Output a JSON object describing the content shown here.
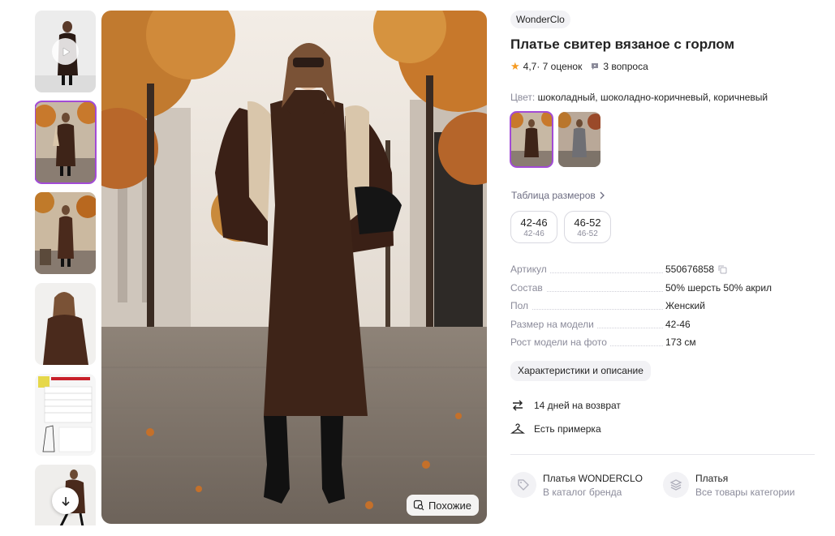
{
  "gallery": {
    "thumbnails": [
      {
        "kind": "video",
        "icon": "play-icon"
      },
      {
        "kind": "photo",
        "active": true
      },
      {
        "kind": "photo"
      },
      {
        "kind": "photo"
      },
      {
        "kind": "size-chart"
      },
      {
        "kind": "photo"
      }
    ],
    "scroll_icon": "arrow-down-icon",
    "similar_label": "Похожие",
    "similar_icon": "image-search-icon"
  },
  "product": {
    "brand": "WonderClo",
    "title": "Платье свитер вязаное с горлом",
    "rating": "4,7",
    "reviews": " · 7 оценок",
    "questions": "3 вопроса",
    "color_label": "Цвет:",
    "color_value": "шоколадный, шоколадно-коричневый, коричневый",
    "size_table_label": "Таблица размеров",
    "sizes": [
      {
        "label": "42-46",
        "ru": "42-46"
      },
      {
        "label": "46-52",
        "ru": "46-52"
      }
    ],
    "specs": [
      {
        "key": "Артикул",
        "value": "550676858",
        "copy": true
      },
      {
        "key": "Состав",
        "value": "50% шерсть 50% акрил"
      },
      {
        "key": "Пол",
        "value": "Женский"
      },
      {
        "key": "Размер на модели",
        "value": "42-46"
      },
      {
        "key": "Рост модели на фото",
        "value": "173 см"
      }
    ],
    "characteristics_button": "Характеристики и описание",
    "features": [
      {
        "icon": "return-arrows-icon",
        "text": "14 дней на возврат"
      },
      {
        "icon": "hanger-icon",
        "text": "Есть примерка"
      }
    ],
    "links": [
      {
        "icon": "tag-icon",
        "title": "Платья WONDERCLO",
        "subtitle": "В каталог бренда"
      },
      {
        "icon": "layers-icon",
        "title": "Платья",
        "subtitle": "Все товары категории"
      }
    ]
  },
  "colors": {
    "accent": "#a24bd6",
    "star": "#f59b22",
    "muted": "#8b8b9a",
    "chip_bg": "#f2f2f5",
    "dress": "#3e2418"
  }
}
